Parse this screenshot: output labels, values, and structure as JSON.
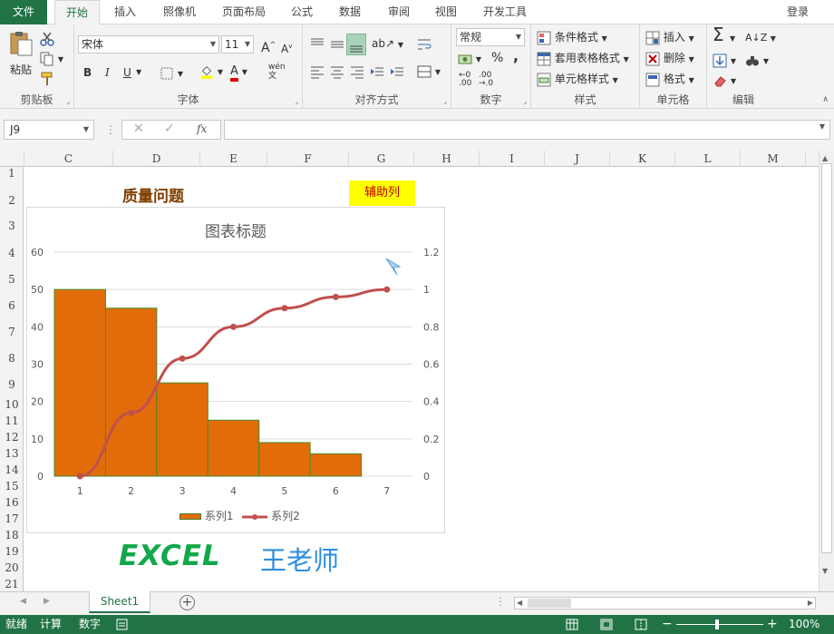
{
  "menu": {
    "file": "文件",
    "tabs": [
      "开始",
      "插入",
      "照像机",
      "页面布局",
      "公式",
      "数据",
      "审阅",
      "视图",
      "开发工具"
    ],
    "login": "登录"
  },
  "ribbon": {
    "clipboard": {
      "label": "剪贴板",
      "paste": "粘贴"
    },
    "font": {
      "label": "字体",
      "name": "宋体",
      "size": "11",
      "bold": "B",
      "italic": "I",
      "underline": "U",
      "phonetic": "wén"
    },
    "alignment": {
      "label": "对齐方式"
    },
    "number": {
      "label": "数字",
      "format": "常规",
      "percent": "%",
      "comma": ","
    },
    "styles": {
      "label": "样式",
      "conditional": "条件格式",
      "table": "套用表格格式",
      "cell": "单元格样式"
    },
    "cells": {
      "label": "单元格",
      "insert": "插入",
      "delete": "删除",
      "format": "格式"
    },
    "editing": {
      "label": "编辑"
    }
  },
  "formula_bar": {
    "name_box": "J9",
    "fx": "fx",
    "content": ""
  },
  "columns": [
    "C",
    "D",
    "E",
    "F",
    "G",
    "H",
    "I",
    "J",
    "K",
    "L",
    "M"
  ],
  "rows": [
    "1",
    "2",
    "3",
    "4",
    "5",
    "6",
    "7",
    "8",
    "9",
    "10",
    "11",
    "12",
    "13",
    "14",
    "15",
    "16",
    "17",
    "18",
    "19",
    "20",
    "21"
  ],
  "cells": {
    "title": "质量问题",
    "helper_col": "辅助列",
    "watermark_left": "EXCEL",
    "watermark_right": "王老师"
  },
  "colors": {
    "accent": "#217346",
    "bar": "#e36c0a",
    "line": "#c0504d",
    "title_text": "#7f3f00",
    "helper_bg": "#ffff00",
    "helper_text": "#c00000",
    "wm_left": "#12a84a",
    "wm_right": "#2e8ede"
  },
  "chart_data": {
    "type": "bar",
    "title": "图表标题",
    "categories": [
      "1",
      "2",
      "3",
      "4",
      "5",
      "6",
      "7"
    ],
    "series": [
      {
        "name": "系列1",
        "type": "bar",
        "axis": "left",
        "values": [
          50,
          45,
          25,
          15,
          9,
          6,
          0
        ]
      },
      {
        "name": "系列2",
        "type": "line",
        "axis": "right",
        "values": [
          0,
          0.34,
          0.63,
          0.8,
          0.9,
          0.96,
          1.0
        ]
      }
    ],
    "y_left": {
      "min": 0,
      "max": 60,
      "ticks": [
        "0",
        "10",
        "20",
        "30",
        "40",
        "50",
        "60"
      ]
    },
    "y_right": {
      "min": 0,
      "max": 1.2,
      "ticks": [
        "0",
        "0.2",
        "0.4",
        "0.6",
        "0.8",
        "1",
        "1.2"
      ]
    },
    "grid": true,
    "legend": "bottom"
  },
  "sheets": {
    "tabs": [
      "Sheet1"
    ],
    "add": "+"
  },
  "status": {
    "ready": "就绪",
    "calc": "计算",
    "num": "数字",
    "zoom": "100%"
  }
}
